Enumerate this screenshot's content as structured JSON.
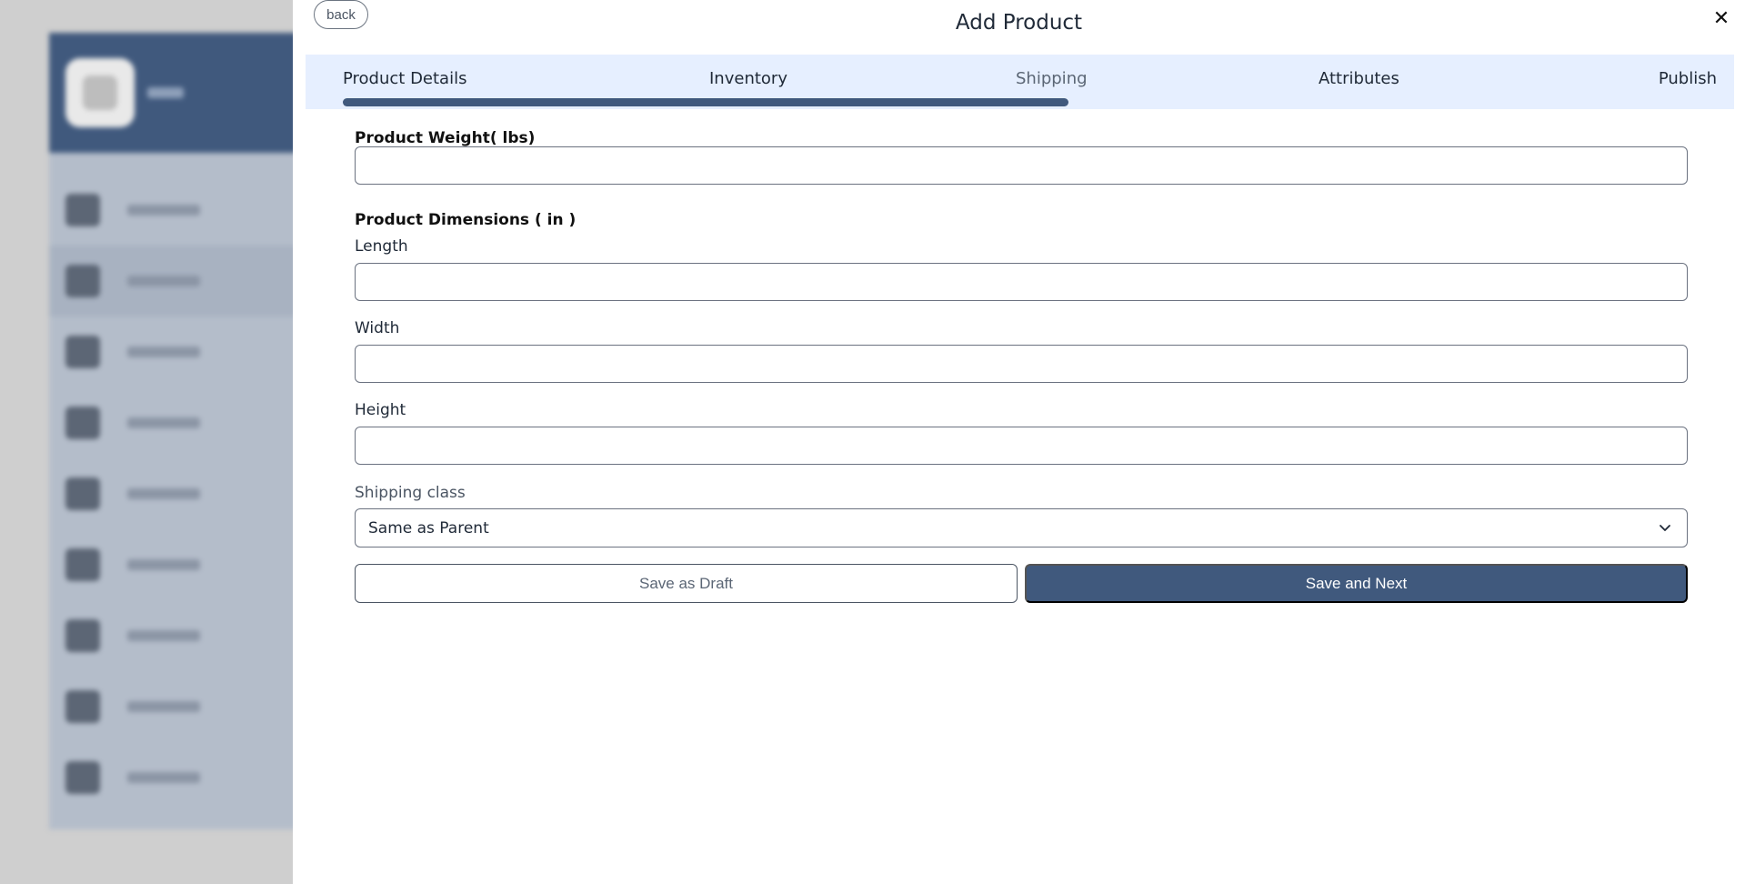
{
  "modal": {
    "title": "Add Product",
    "back_label": "back",
    "close_glyph": "✕"
  },
  "tabs": [
    {
      "label": "Product Details"
    },
    {
      "label": "Inventory"
    },
    {
      "label": "Shipping"
    },
    {
      "label": "Attributes"
    },
    {
      "label": "Publish"
    }
  ],
  "progress": {
    "current_step": 3,
    "total_steps": 5
  },
  "form": {
    "weight_label": "Product Weight( lbs)",
    "weight_value": "",
    "dimensions_label": "Product Dimensions ( in )",
    "length_label": "Length",
    "length_value": "",
    "width_label": "Width",
    "width_value": "",
    "height_label": "Height",
    "height_value": "",
    "shipping_class_label": "Shipping class",
    "shipping_class_value": "Same as Parent"
  },
  "actions": {
    "draft_label": "Save as Draft",
    "next_label": "Save and Next"
  },
  "colors": {
    "brand": "#40597d",
    "tab_bar": "#e6efff"
  }
}
